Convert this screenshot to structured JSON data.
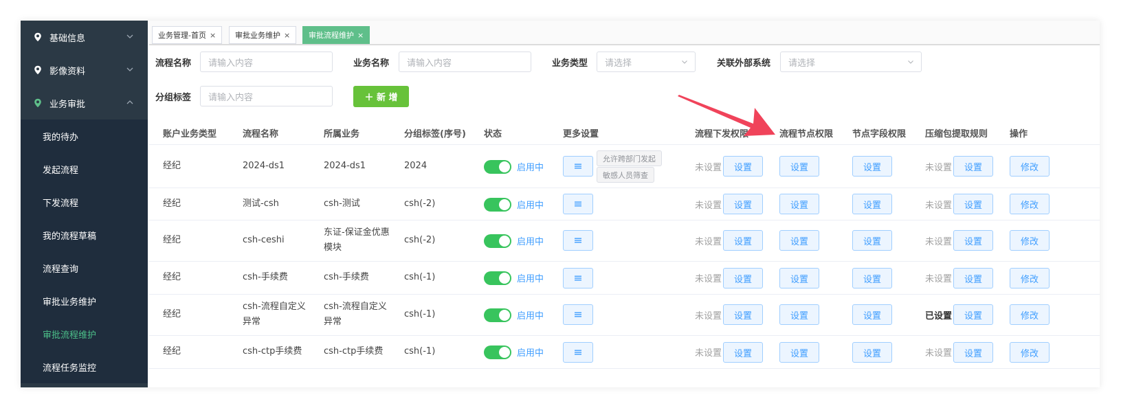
{
  "sidebar": {
    "groups": [
      {
        "label": "基础信息"
      },
      {
        "label": "影像资料"
      },
      {
        "label": "业务审批"
      }
    ],
    "items": [
      {
        "label": "我的待办"
      },
      {
        "label": "发起流程"
      },
      {
        "label": "下发流程"
      },
      {
        "label": "我的流程草稿"
      },
      {
        "label": "流程查询"
      },
      {
        "label": "审批业务维护"
      },
      {
        "label": "审批流程维护"
      },
      {
        "label": "流程任务监控"
      }
    ]
  },
  "tabs": [
    {
      "label": "业务管理-首页"
    },
    {
      "label": "审批业务维护"
    },
    {
      "label": "审批流程维护"
    }
  ],
  "filters": {
    "flow_name": {
      "label": "流程名称",
      "placeholder": "请输入内容"
    },
    "biz_name": {
      "label": "业务名称",
      "placeholder": "请输入内容"
    },
    "biz_type": {
      "label": "业务类型",
      "placeholder": "请选择"
    },
    "ext_system": {
      "label": "关联外部系统",
      "placeholder": "请选择"
    },
    "group_tag": {
      "label": "分组标签",
      "placeholder": "请输入内容"
    },
    "add_button": "＋ 新 增"
  },
  "table": {
    "headers": [
      "账户业务类型",
      "流程名称",
      "所属业务",
      "分组标签(序号)",
      "状态",
      "更多设置",
      "流程下发权限",
      "流程节点权限",
      "节点字段权限",
      "压缩包提取规则",
      "操作"
    ],
    "set_label": "设置",
    "edit_label": "修改",
    "unset_label": "未设置",
    "rows": [
      {
        "type": "经纪",
        "flow": "2024-ds1",
        "biz": "2024-ds1",
        "tag": "2024",
        "status": "启用中",
        "tags": [
          "允许跨部门发起",
          "敏感人员筛查"
        ],
        "zip_status": "未设置"
      },
      {
        "type": "经纪",
        "flow": "测试-csh",
        "biz": "csh-测试",
        "tag": "csh(-2)",
        "status": "启用中",
        "tags": [],
        "zip_status": "未设置"
      },
      {
        "type": "经纪",
        "flow": "csh-ceshi",
        "biz": "东证-保证金优惠模块",
        "tag": "csh(-2)",
        "status": "启用中",
        "tags": [],
        "zip_status": "未设置"
      },
      {
        "type": "经纪",
        "flow": "csh-手续费",
        "biz": "csh-手续费",
        "tag": "csh(-1)",
        "status": "启用中",
        "tags": [],
        "zip_status": "未设置"
      },
      {
        "type": "经纪",
        "flow": "csh-流程自定义异常",
        "biz": "csh-流程自定义异常",
        "tag": "csh(-1)",
        "status": "启用中",
        "tags": [],
        "zip_status": "已设置"
      },
      {
        "type": "经纪",
        "flow": "csh-ctp手续费",
        "biz": "csh-ctp手续费",
        "tag": "csh(-1)",
        "status": "启用中",
        "tags": [],
        "zip_status": "未设置"
      }
    ]
  },
  "colors": {
    "sidebar_bg": "#2b3945",
    "submenu_bg": "#1f2d3d",
    "accent_green": "#5fbf8a",
    "add_button": "#67c23a",
    "switch_on": "#38c45d",
    "link_blue": "#409eff",
    "annotation_arrow": "#f0435a"
  },
  "icons": {
    "menu_group": "location-pin-icon",
    "more_settings": "hamburger-menu-icon",
    "select": "chevron-down-icon"
  }
}
